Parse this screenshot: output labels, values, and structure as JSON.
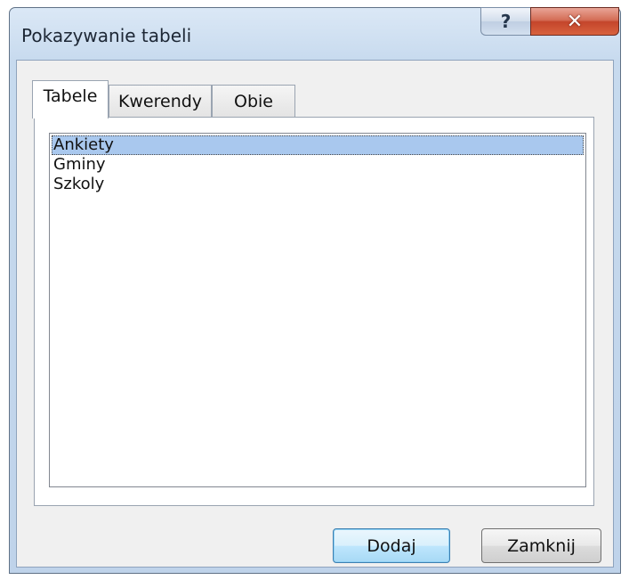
{
  "dialog": {
    "title": "Pokazywanie tabeli",
    "help_label": "?",
    "close_label": "✕"
  },
  "tabs": [
    {
      "label": "Tabele",
      "active": true
    },
    {
      "label": "Kwerendy",
      "active": false
    },
    {
      "label": "Obie",
      "active": false
    }
  ],
  "list": {
    "items": [
      {
        "label": "Ankiety",
        "selected": true
      },
      {
        "label": "Gminy",
        "selected": false
      },
      {
        "label": "Szkoly",
        "selected": false
      }
    ]
  },
  "buttons": {
    "add_label": "Dodaj",
    "close_label": "Zamknij"
  }
}
